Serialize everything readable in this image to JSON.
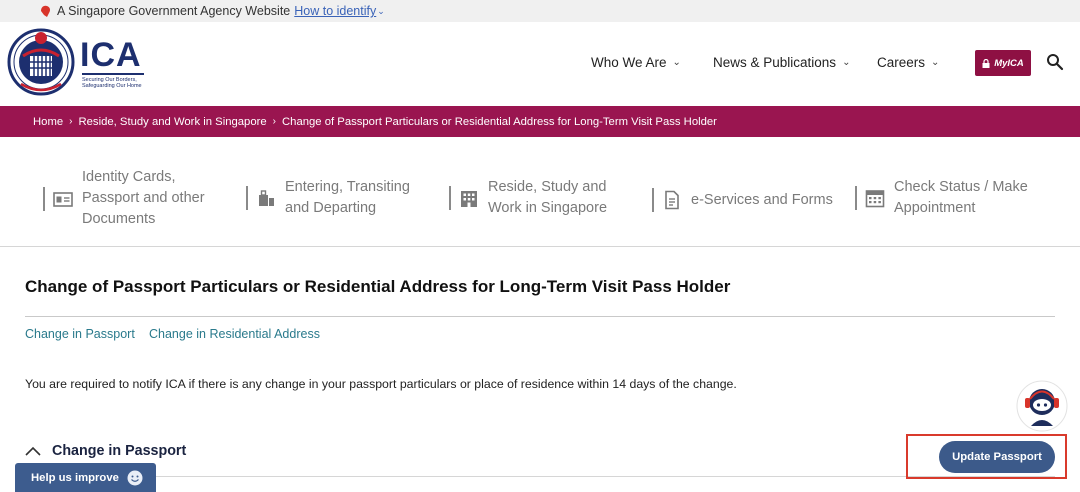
{
  "gov_banner": {
    "text": "A Singapore Government Agency Website",
    "link": "How to identify",
    "chevron": "⌄"
  },
  "header": {
    "logo_text": "ICA",
    "tagline": "Securing Our Borders, Safeguarding Our Home",
    "nav": [
      {
        "label": "Who We Are",
        "chevron": "⌄"
      },
      {
        "label": "News & Publications",
        "chevron": "⌄"
      },
      {
        "label": "Careers",
        "chevron": "⌄"
      }
    ],
    "myica_label": "MyICA",
    "icons": {
      "search": "search-icon",
      "lock": "lock-icon"
    }
  },
  "breadcrumb": {
    "items": [
      "Home",
      "Reside, Study and Work in Singapore",
      "Change of Passport Particulars or Residential Address for Long-Term Visit Pass Holder"
    ],
    "separator": "›"
  },
  "categories": [
    {
      "lines": [
        "Identity Cards,",
        "Passport and other",
        "Documents"
      ],
      "icon": "id-card-icon"
    },
    {
      "lines": [
        "Entering, Transiting",
        "and Departing"
      ],
      "icon": "luggage-icon"
    },
    {
      "lines": [
        "Reside, Study and",
        "Work in Singapore"
      ],
      "icon": "building-icon"
    },
    {
      "lines": [
        "e-Services and Forms"
      ],
      "icon": "document-icon"
    },
    {
      "lines": [
        "Check Status / Make",
        "Appointment"
      ],
      "icon": "calendar-icon"
    }
  ],
  "main": {
    "title": "Change of Passport Particulars or Residential Address for Long-Term Visit Pass Holder",
    "anchors": [
      "Change in Passport",
      "Change in Residential Address"
    ],
    "notice": "You are required to notify ICA if there is any change in your passport particulars or place of residence within 14 days of the change.",
    "section_title": "Change in Passport",
    "update_button": "Update Passport"
  },
  "help_tab": {
    "label": "Help us improve"
  },
  "colors": {
    "brand_maroon": "#9a1550",
    "navy": "#1d2f6f",
    "button_blue": "#3c5a8a",
    "link_teal": "#2a7a8c",
    "highlight_red": "#d93a2c"
  }
}
